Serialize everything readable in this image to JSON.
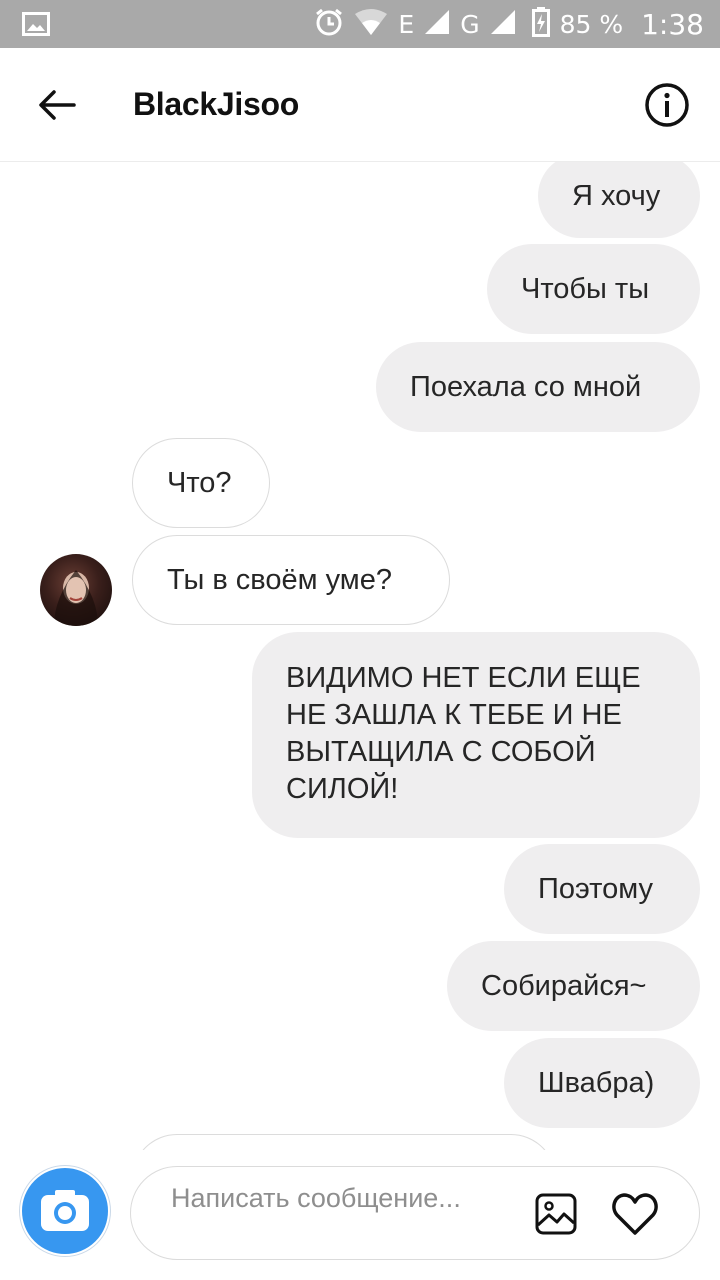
{
  "status_bar": {
    "notification_icon": "image-icon",
    "network": "E",
    "network2": "G",
    "battery": "85 %",
    "time": "1:38"
  },
  "header": {
    "title": "BlackJisoo",
    "back_icon": "arrow-left-icon",
    "info_icon": "info-icon"
  },
  "messages": [
    {
      "side": "out",
      "text": "Я хочу"
    },
    {
      "side": "out",
      "text": "Чтобы ты"
    },
    {
      "side": "out",
      "text": "Поехала со мной"
    },
    {
      "side": "in",
      "text": "Что?"
    },
    {
      "side": "in",
      "text": "Ты в своём уме?"
    },
    {
      "side": "out",
      "text": "ВИДИМО НЕТ ЕСЛИ ЕЩЕ НЕ ЗАШЛА К ТЕБЕ И НЕ ВЫТАЩИЛА С СОБОЙ СИЛОЙ!"
    },
    {
      "side": "out",
      "text": "Поэтому"
    },
    {
      "side": "out",
      "text": "Собирайся~"
    },
    {
      "side": "out",
      "text": "Швабра)"
    }
  ],
  "composer": {
    "placeholder": "Написать сообщение...",
    "camera_icon": "camera-icon",
    "gallery_icon": "gallery-icon",
    "heart_icon": "heart-icon"
  },
  "colors": {
    "status_bar": "#a9a9a9",
    "outgoing_bubble": "#efeeef",
    "accent": "#3797f0"
  }
}
